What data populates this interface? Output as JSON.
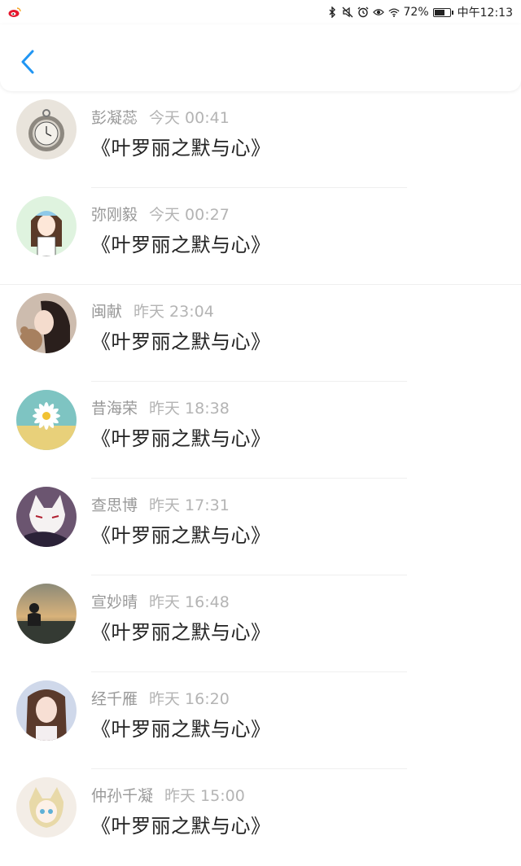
{
  "status_bar": {
    "left_icon": "weibo-icon",
    "right_icons": [
      "bluetooth-icon",
      "mute-icon",
      "alarm-icon",
      "eye-icon",
      "wifi-icon"
    ],
    "battery_percent": "72%",
    "battery_level": 0.72,
    "time": "中午12:13"
  },
  "header": {
    "back_icon": "chevron-left-icon",
    "accent": "#2196f3"
  },
  "items": [
    {
      "name": "彭凝蕊",
      "time": "今天 00:41",
      "title": "《叶罗丽之默与心》",
      "avatar": "pocket-watch-avatar"
    },
    {
      "name": "弥刚毅",
      "time": "今天 00:27",
      "title": "《叶罗丽之默与心》",
      "avatar": "anime-girl-avatar"
    },
    {
      "name": "闽献",
      "time": "昨天 23:04",
      "title": "《叶罗丽之默与心》",
      "avatar": "girl-teddy-avatar"
    },
    {
      "name": "昔海荣",
      "time": "昨天 18:38",
      "title": "《叶罗丽之默与心》",
      "avatar": "daisy-avatar"
    },
    {
      "name": "查思博",
      "time": "昨天 17:31",
      "title": "《叶罗丽之默与心》",
      "avatar": "fox-mask-avatar"
    },
    {
      "name": "宣妙晴",
      "time": "昨天 16:48",
      "title": "《叶罗丽之默与心》",
      "avatar": "sunset-avatar"
    },
    {
      "name": "经千雁",
      "time": "昨天 16:20",
      "title": "《叶罗丽之默与心》",
      "avatar": "girl-portrait-avatar"
    },
    {
      "name": "仲孙千凝",
      "time": "昨天 15:00",
      "title": "《叶罗丽之默与心》",
      "avatar": "anime-cat-avatar"
    }
  ]
}
